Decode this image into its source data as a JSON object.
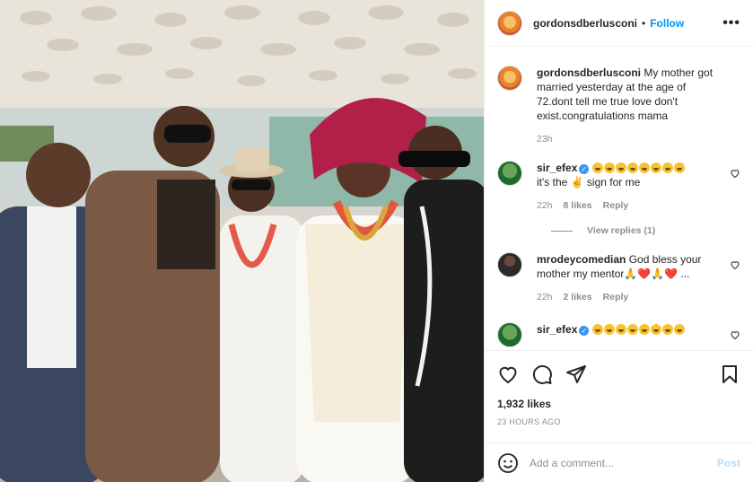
{
  "post": {
    "username": "gordonsdberlusconi",
    "follow_label": "Follow",
    "separator": "•",
    "more_label": "•••",
    "caption": "My mother got married yesterday at the age of 72.dont tell me true love don't exist.congratulations mama",
    "caption_time": "23h",
    "likes": "1,932 likes",
    "posted_ago": "23 HOURS AGO"
  },
  "comments": [
    {
      "username": "sir_efex",
      "text_tail": "it's the ✌️ sign for me",
      "time": "22h",
      "likes": "8 likes",
      "reply_label": "Reply",
      "view_replies": "View replies (1)"
    },
    {
      "username": "mrodeycomedian",
      "text": "God bless your mother my mentor🙏❤️🙏❤️ ...",
      "time": "22h",
      "likes": "2 likes",
      "reply_label": "Reply"
    },
    {
      "username": "sir_efex"
    }
  ],
  "composer": {
    "placeholder": "Add a comment...",
    "post_label": "Post"
  },
  "icons": {
    "like": "heart-icon",
    "comment": "comment-icon",
    "share": "share-icon",
    "save": "bookmark-icon",
    "emoji": "smiley-icon",
    "verified": "verified-badge-icon"
  },
  "colors": {
    "link_blue": "#0095f6",
    "post_disabled": "#b2dffc",
    "muted": "#8e8e8e",
    "border": "#efefef"
  }
}
